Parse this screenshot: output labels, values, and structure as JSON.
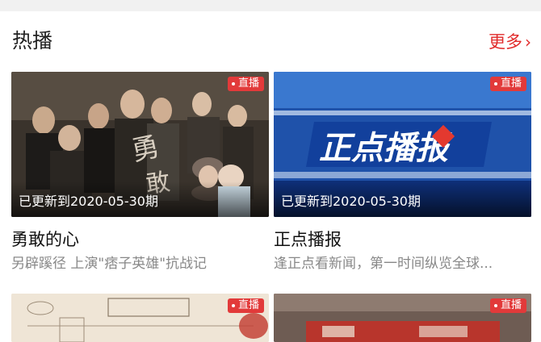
{
  "section": {
    "title": "热播",
    "more_label": "更多"
  },
  "badge_label": "直播",
  "cards": [
    {
      "title": "勇敢的心",
      "update": "已更新到2020-05-30期",
      "desc": "另辟蹊径 上演\"痞子英雄\"抗战记"
    },
    {
      "title": "正点播报",
      "update": "已更新到2020-05-30期",
      "desc": "逢正点看新闻，第一时间纵览全球..."
    },
    {
      "title": "",
      "update": "",
      "desc": ""
    },
    {
      "title": "",
      "update": "",
      "desc": ""
    }
  ],
  "logo_text": {
    "zhengdian": "正点播报"
  },
  "colors": {
    "accent": "#e12b2b",
    "badge": "#e23a3a"
  }
}
